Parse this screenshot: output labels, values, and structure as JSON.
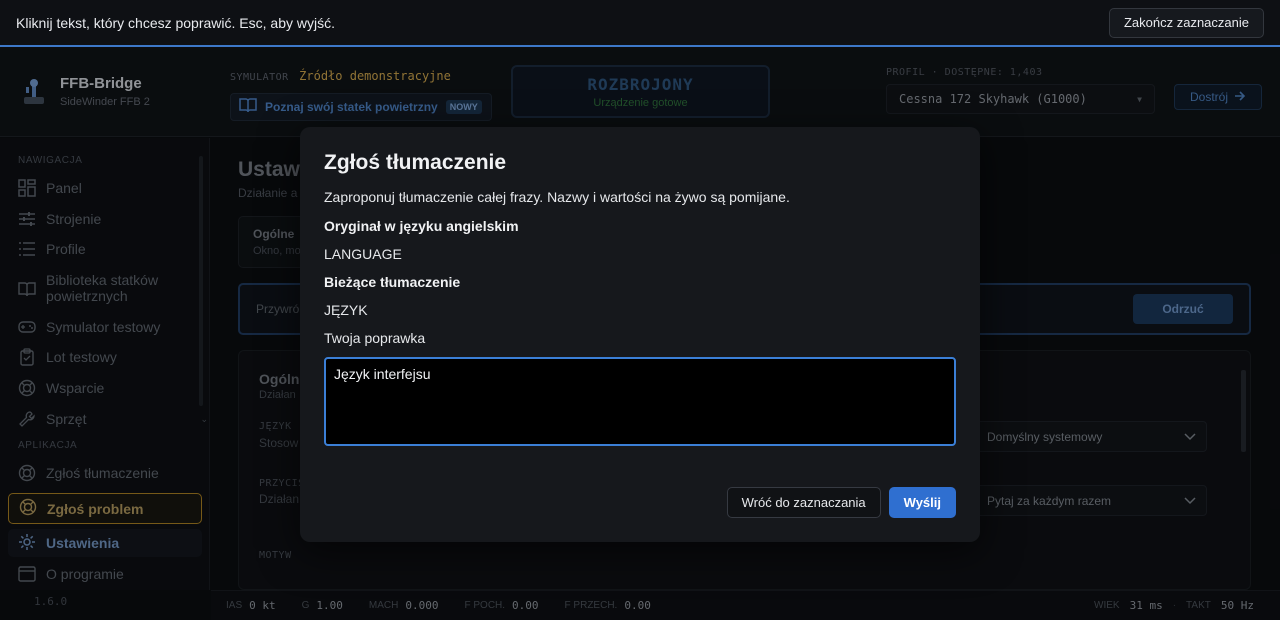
{
  "banner": {
    "message": "Kliknij tekst, który chcesz poprawić. Esc, aby wyjść.",
    "finish_label": "Zakończ zaznaczanie"
  },
  "brand": {
    "name": "FFB-Bridge",
    "subtitle": "SideWinder FFB 2"
  },
  "simulator": {
    "label": "SYMULATOR",
    "source": "Źródło demonstracyjne",
    "learn_label": "Poznaj swój statek powietrzny",
    "new_badge": "NOWY"
  },
  "status": {
    "main": "ROZBROJONY",
    "sub": "Urządzenie gotowe"
  },
  "profile": {
    "label": "PROFIL · DOSTĘPNE: 1,403",
    "selected": "Cessna 172 Skyhawk (G1000)",
    "apply_label": "Dostrój"
  },
  "sidebar": {
    "nav_label": "NAWIGACJA",
    "items": [
      {
        "label": "Panel",
        "icon": "grid-icon"
      },
      {
        "label": "Strojenie",
        "icon": "sliders-icon"
      },
      {
        "label": "Profile",
        "icon": "list-icon"
      },
      {
        "label": "Biblioteka statków powietrznych",
        "icon": "book-icon"
      },
      {
        "label": "Symulator testowy",
        "icon": "gamepad-icon"
      },
      {
        "label": "Lot testowy",
        "icon": "clipboard-icon"
      },
      {
        "label": "Wsparcie",
        "icon": "lifebuoy-icon"
      },
      {
        "label": "Sprzęt",
        "icon": "wrench-icon"
      }
    ],
    "app_label": "APLIKACJA",
    "app_items": [
      {
        "label": "Zgłoś tłumaczenie",
        "icon": "lifebuoy-icon"
      },
      {
        "label": "Zgłoś problem",
        "icon": "lifebuoy-icon"
      },
      {
        "label": "Ustawienia",
        "icon": "gear-icon"
      },
      {
        "label": "O programie",
        "icon": "window-icon"
      }
    ],
    "version": "1.6.0"
  },
  "main": {
    "title": "Ustaw",
    "subtitle": "Działanie a",
    "card_title": "Ogólne",
    "card_sub": "Okno, mo",
    "restore_text": "Przywró",
    "reject_label": "Odrzuć",
    "panel_title": "Ogóln",
    "panel_sub": "Działan",
    "language_label": "JĘZYK",
    "language_desc": "Stosow",
    "language_value": "Domyślny systemowy",
    "buttons_label": "PRZYCIS",
    "buttons_desc": "Działan",
    "buttons_value": "Pytaj za każdym razem",
    "theme_label": "MOTYW"
  },
  "footer": {
    "ias_label": "IAS",
    "ias_value": "0 kt",
    "g_label": "G",
    "g_value": "1.00",
    "mach_label": "MACH",
    "mach_value": "0.000",
    "fpitch_label": "F POCH.",
    "fpitch_value": "0.00",
    "froll_label": "F PRZECH.",
    "froll_value": "0.00",
    "age_label": "WIEK",
    "age_value": "31 ms",
    "rate_label": "TAKT",
    "rate_value": "50 Hz"
  },
  "modal": {
    "title": "Zgłoś tłumaczenie",
    "description": "Zaproponuj tłumaczenie całej frazy. Nazwy i wartości na żywo są pomijane.",
    "original_label": "Oryginał w języku angielskim",
    "original_value": "LANGUAGE",
    "current_label": "Bieżące tłumaczenie",
    "current_value": "JĘZYK",
    "correction_label": "Twoja poprawka",
    "correction_value": "Język interfejsu",
    "back_label": "Wróć do zaznaczania",
    "send_label": "Wyślij"
  },
  "colors": {
    "accent": "#2f6fd0",
    "banner_line": "#3d78c9",
    "warning_border": "#a47c22"
  }
}
